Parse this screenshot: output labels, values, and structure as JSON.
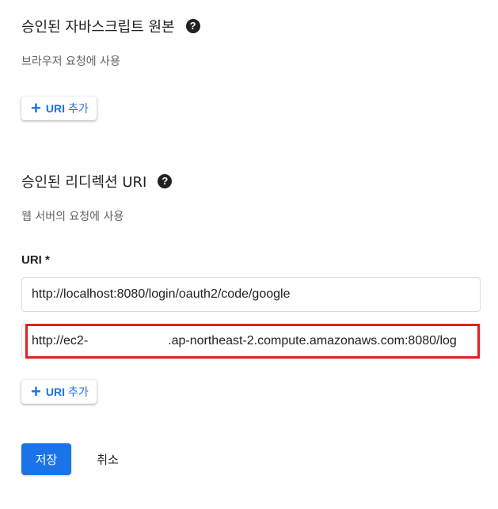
{
  "js_origins": {
    "title": "승인된 자바스크립트 원본",
    "help_icon": "?",
    "description": "브라우저 요청에 사용",
    "add_button": {
      "plus": "+",
      "uri": "URI",
      "label": "추가"
    }
  },
  "redirect_uris": {
    "title": "승인된 리디렉션 URI",
    "help_icon": "?",
    "description": "웹 서버의 요청에 사용",
    "field_label": "URI *",
    "uri_1": "http://localhost:8080/login/oauth2/code/google",
    "uri_2_prefix": "http://ec2-",
    "uri_2_suffix": ".ap-northeast-2.compute.amazonaws.com:8080/log",
    "add_button": {
      "plus": "+",
      "uri": "URI",
      "label": "추가"
    }
  },
  "actions": {
    "save_label": "저장",
    "cancel_label": "취소"
  },
  "colors": {
    "accent": "#1a73e8",
    "highlight": "#e02020"
  }
}
